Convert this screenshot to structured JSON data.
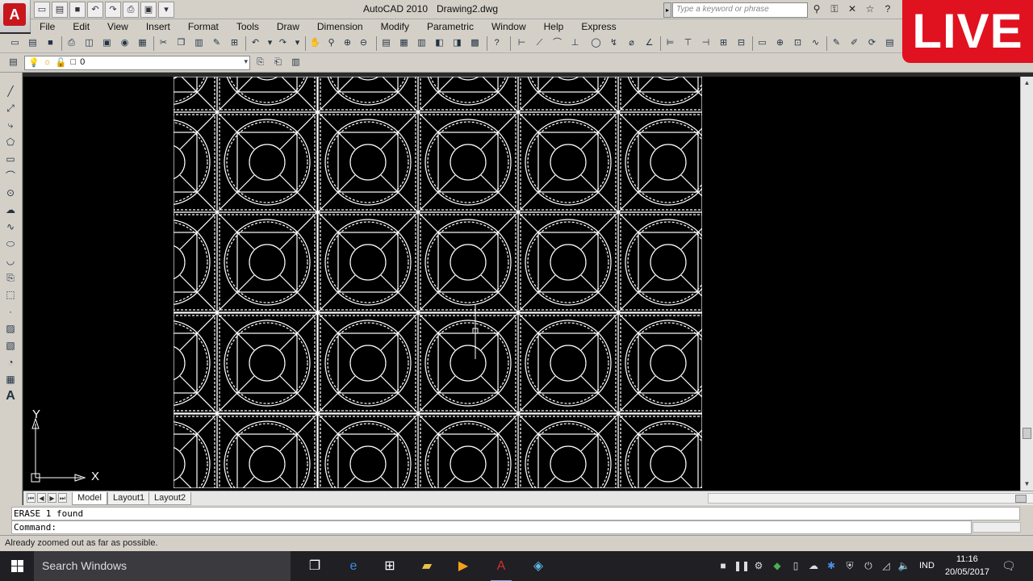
{
  "app": {
    "title_app": "AutoCAD 2010",
    "title_doc": "Drawing2.dwg",
    "logo_letter": "A",
    "accent_color": "#c8161d"
  },
  "search": {
    "placeholder": "Type a keyword or phrase"
  },
  "menu": [
    "File",
    "Edit",
    "View",
    "Insert",
    "Format",
    "Tools",
    "Draw",
    "Dimension",
    "Modify",
    "Parametric",
    "Window",
    "Help",
    "Express"
  ],
  "layer": {
    "current": "0"
  },
  "live_badge": {
    "label": "LIVE",
    "color": "#e0121f"
  },
  "ucs": {
    "x_label": "X",
    "y_label": "Y"
  },
  "tabs": {
    "model": "Model",
    "layout1": "Layout1",
    "layout2": "Layout2"
  },
  "command": {
    "history_line": "ERASE 1 found",
    "prompt": "Command:"
  },
  "status": {
    "message": "Already zoomed out as far as possible."
  },
  "taskbar": {
    "search_text": "Search Windows",
    "language": "IND",
    "time": "11:16",
    "date": "20/05/2017"
  }
}
